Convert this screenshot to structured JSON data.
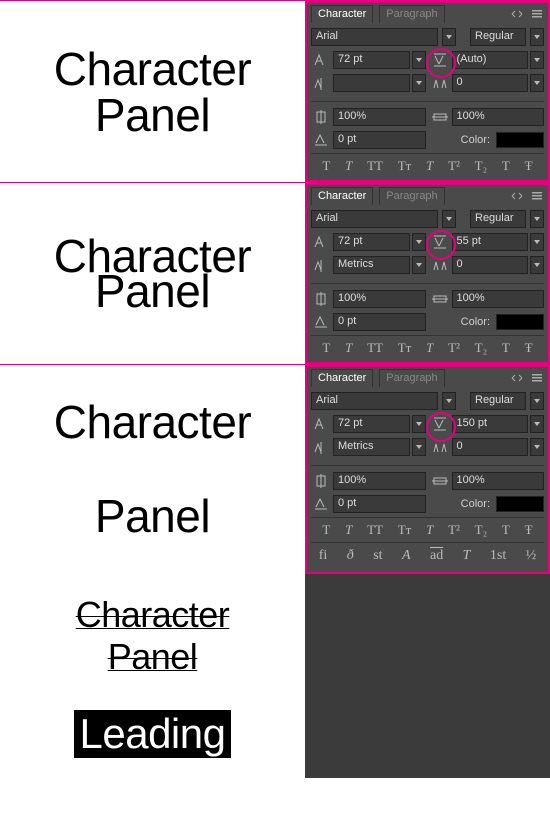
{
  "tab_character": "Character",
  "tab_paragraph": "Paragraph",
  "leading_label": "Leading",
  "panels": [
    {
      "sample": [
        "Character",
        "Panel"
      ],
      "font": "Arial",
      "style": "Regular",
      "size": "72 pt",
      "leading": "(Auto)",
      "kerning": "",
      "tracking": "0",
      "vscale": "100%",
      "hscale": "100%",
      "baseline": "0 pt",
      "color_label": "Color:",
      "open_type": false
    },
    {
      "sample": [
        "Character",
        "Panel"
      ],
      "font": "Arial",
      "style": "Regular",
      "size": "72 pt",
      "leading": "55 pt",
      "kerning": "Metrics",
      "tracking": "0",
      "vscale": "100%",
      "hscale": "100%",
      "baseline": "0 pt",
      "color_label": "Color:",
      "open_type": false
    },
    {
      "sample": [
        "Character",
        "Panel"
      ],
      "font": "Arial",
      "style": "Regular",
      "size": "72 pt",
      "leading": "150 pt",
      "kerning": "Metrics",
      "tracking": "0",
      "vscale": "100%",
      "hscale": "100%",
      "baseline": "0 pt",
      "color_label": "Color:",
      "open_type": true
    }
  ],
  "bottom_sample": [
    "Character",
    "Panel"
  ],
  "type_row": [
    "T",
    "T",
    "TT",
    "Tт",
    "T",
    "T²",
    "T₂",
    "T",
    "Ŧ"
  ]
}
